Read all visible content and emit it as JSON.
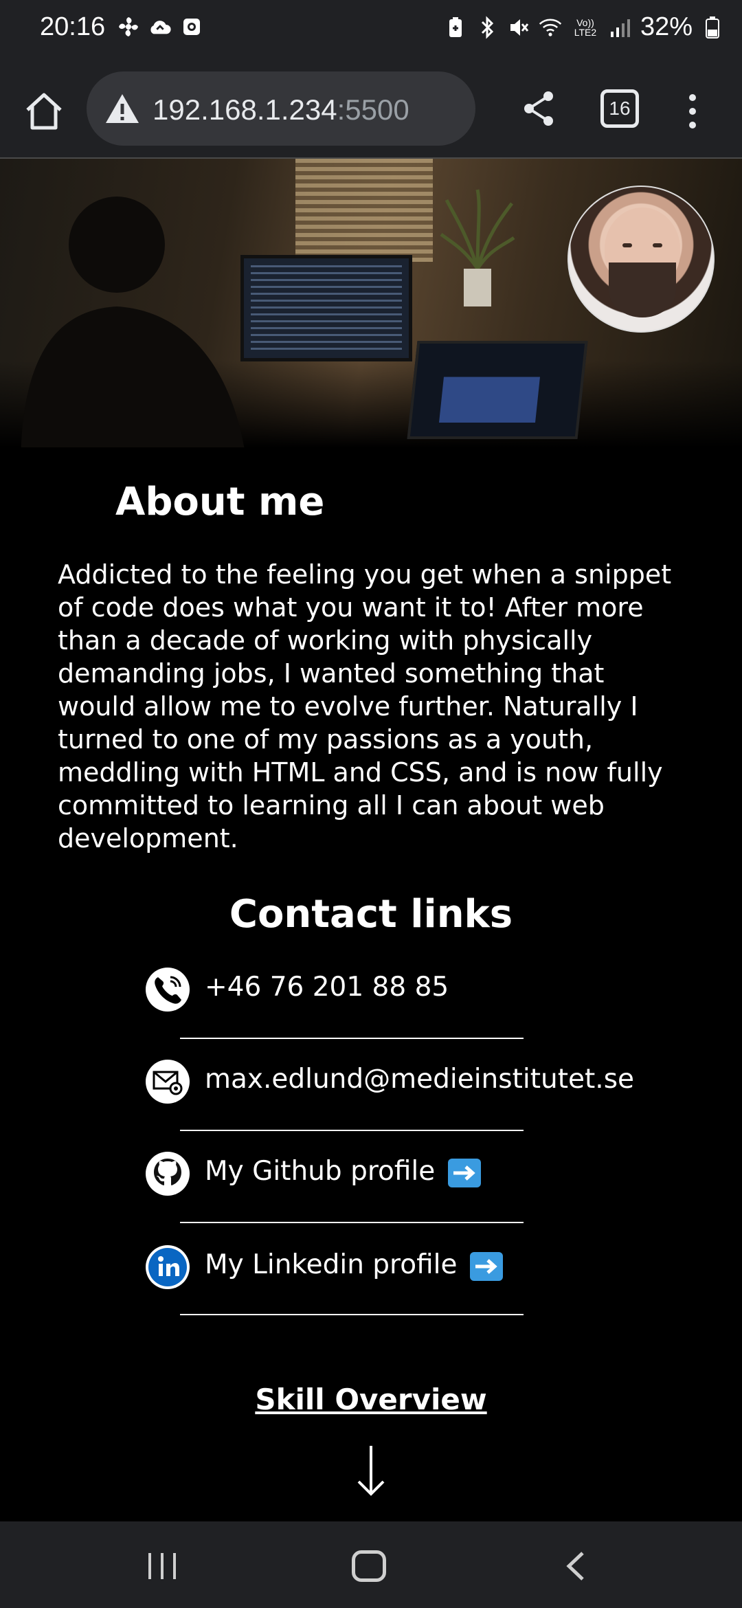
{
  "status_bar": {
    "time": "20:16",
    "battery": "32%",
    "icons_left": [
      "fan-icon",
      "cloud-sync-icon",
      "screen-record-icon"
    ],
    "icons_right": [
      "battery-saver-icon",
      "bluetooth-icon",
      "mute-icon",
      "wifi-icon",
      "volte-icon",
      "signal-icon",
      "battery-icon"
    ],
    "volte": "Vo)) LTE2"
  },
  "browser": {
    "url_host": "192.168.1.234",
    "url_port": ":5500",
    "tab_count": "16"
  },
  "about": {
    "title": "About me",
    "text": "Addicted to the feeling you get when a snippet of code does what you want it to! After more than a decade of working with physically demanding jobs, I wanted something that would allow me to evolve further. Naturally I turned to one of my passions as a youth, meddling with HTML and CSS, and is now fully committed to learning all I can about web development."
  },
  "contact": {
    "title": "Contact links",
    "items": [
      {
        "label": "+46 76 201 88 85",
        "icon": "phone-icon"
      },
      {
        "label": "max.edlund@medieinstitutet.se",
        "icon": "email-icon"
      },
      {
        "label": "My Github profile",
        "icon": "github-icon"
      },
      {
        "label": "My Linkedin profile",
        "icon": "linkedin-icon"
      }
    ]
  },
  "skills": {
    "link_label": "Skill Overview"
  },
  "colors": {
    "page_bg": "#000000",
    "chrome_bg": "#202124",
    "urlbar_bg": "#35363a",
    "text": "#ffffff",
    "linkedin_blue": "#0a66c2",
    "emoji_arrow_blue": "#3a9be0"
  }
}
